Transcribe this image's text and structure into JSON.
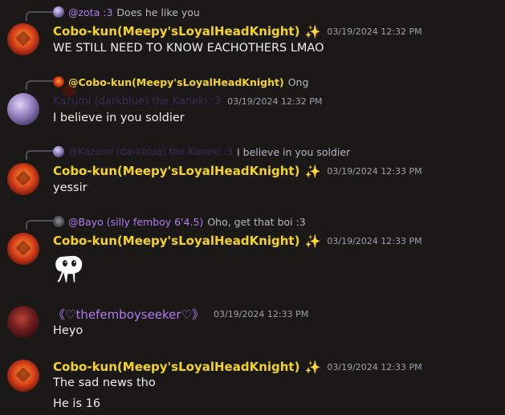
{
  "messages": [
    {
      "reply": {
        "author": "@zota :3",
        "text": "Does he like you"
      },
      "author": "Cobo-kun(Meepy'sLoyalHeadKnight)",
      "timestamp": "03/19/2024 12:32 PM",
      "lines": [
        "WE STILL NEED TO KNOW EACHOTHERS LMAO"
      ]
    },
    {
      "reply": {
        "author": "@Cobo-kun(Meepy'sLoyalHeadKnight)",
        "text": "Ong"
      },
      "author": "Kazumi (darkblue) the Kaneki :3",
      "timestamp": "03/19/2024 12:32 PM",
      "lines": [
        "I believe in you soldier"
      ]
    },
    {
      "reply": {
        "author": "@Kazumi (darkblue) the Kaneki :3",
        "text": "I believe in you soldier"
      },
      "author": "Cobo-kun(Meepy'sLoyalHeadKnight)",
      "timestamp": "03/19/2024 12:33 PM",
      "lines": [
        "yessir"
      ]
    },
    {
      "reply": {
        "author": "@Bayo (silly femboy 6'4.5)",
        "text": "Oho, get that boi :3"
      },
      "author": "Cobo-kun(Meepy'sLoyalHeadKnight)",
      "timestamp": "03/19/2024 12:33 PM",
      "sticker": "white-creature-sticker"
    },
    {
      "author": "《♡thefemboyseeker♡》",
      "timestamp": "03/19/2024 12:33 PM",
      "lines": [
        "Heyo"
      ]
    },
    {
      "author": "Cobo-kun(Meepy'sLoyalHeadKnight)",
      "timestamp": "03/19/2024 12:33 PM",
      "lines": [
        "The sad news tho",
        "He is 16"
      ]
    }
  ],
  "colors": {
    "gold_name": "#f4d324",
    "violet_name": "#b37bf0",
    "background": "#1a1917"
  }
}
